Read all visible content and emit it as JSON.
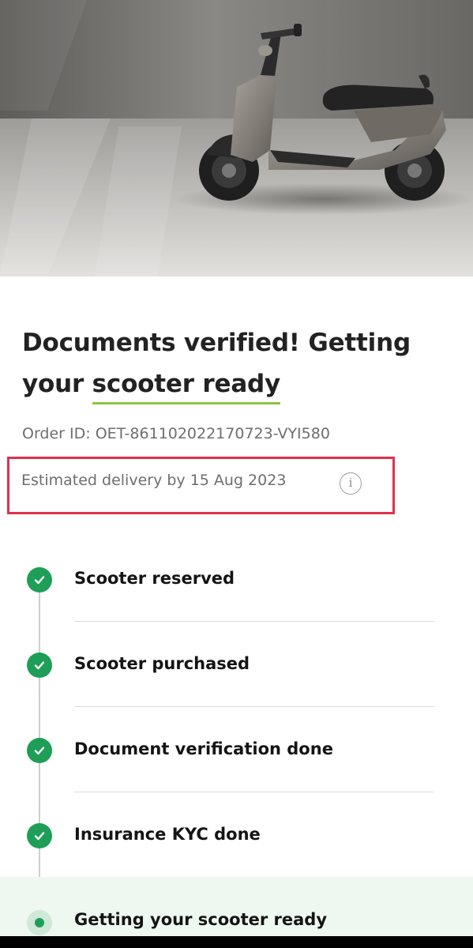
{
  "header": {
    "title_line1": "Documents verified! Getting",
    "title_prefix": "your ",
    "title_highlight": "scooter ready"
  },
  "order": {
    "order_id_label": "Order ID: OET-861102022170723-VYI580"
  },
  "delivery": {
    "text": "Estimated delivery by 15 Aug 2023",
    "info_icon": "info-icon",
    "info_glyph": "i"
  },
  "steps": [
    {
      "label": "Scooter reserved",
      "status": "done"
    },
    {
      "label": "Scooter purchased",
      "status": "done"
    },
    {
      "label": "Document verification done",
      "status": "done"
    },
    {
      "label": "Insurance KYC done",
      "status": "done"
    },
    {
      "label": "Getting your scooter ready",
      "status": "current"
    }
  ],
  "colors": {
    "accent_green": "#1e9e57",
    "underline_green": "#8cc63f",
    "highlight_box_red": "#e0314b",
    "current_step_bg": "#eef7f0"
  }
}
